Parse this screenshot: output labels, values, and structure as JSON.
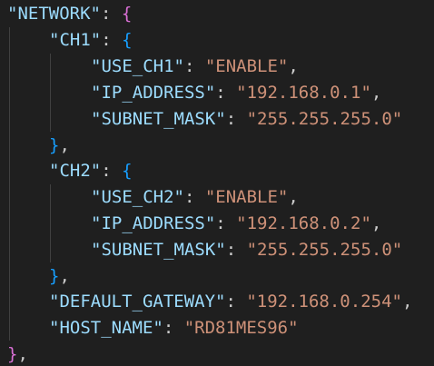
{
  "editor": {
    "network_key": "\"NETWORK\"",
    "ch1": {
      "key": "\"CH1\"",
      "use_key": "\"USE_CH1\"",
      "use_val": "\"ENABLE\"",
      "ip_key": "\"IP_ADDRESS\"",
      "ip_val": "\"192.168.0.1\"",
      "mask_key": "\"SUBNET_MASK\"",
      "mask_val": "\"255.255.255.0\""
    },
    "ch2": {
      "key": "\"CH2\"",
      "use_key": "\"USE_CH2\"",
      "use_val": "\"ENABLE\"",
      "ip_key": "\"IP_ADDRESS\"",
      "ip_val": "\"192.168.0.2\"",
      "mask_key": "\"SUBNET_MASK\"",
      "mask_val": "\"255.255.255.0\""
    },
    "gateway_key": "\"DEFAULT_GATEWAY\"",
    "gateway_val": "\"192.168.0.254\"",
    "host_key": "\"HOST_NAME\"",
    "host_val": "\"RD81MES96\""
  },
  "colors": {
    "background": "#1f1f1f",
    "key": "#9cdcfe",
    "string": "#ce9178",
    "brace_level1": "#da70d6",
    "brace_level2": "#179fff",
    "punctuation": "#cccccc"
  }
}
